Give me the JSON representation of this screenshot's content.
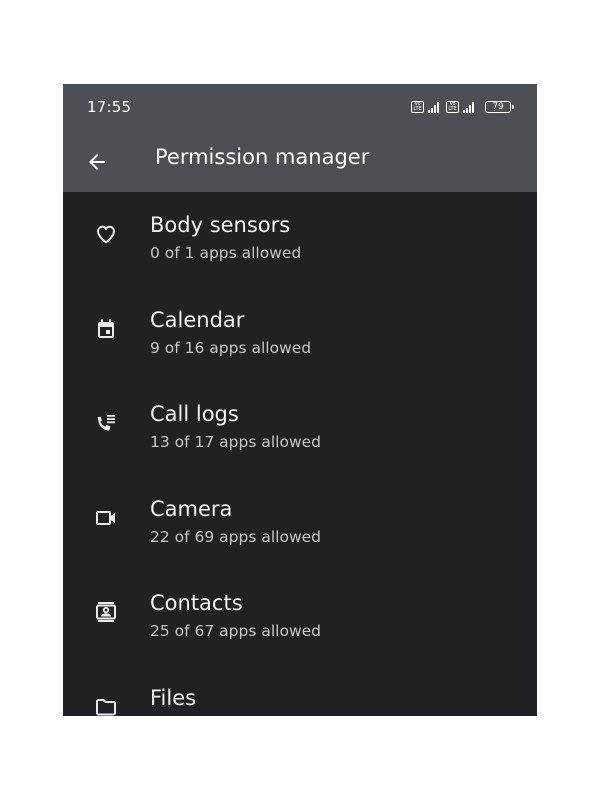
{
  "status_bar": {
    "time": "17:55",
    "sim1_badge": "Vo LTE",
    "sim2_badge": "Vo LTE",
    "battery_level": "79"
  },
  "app_bar": {
    "title": "Permission manager",
    "back_icon": "arrow-back-icon"
  },
  "permissions": [
    {
      "label": "Body sensors",
      "summary": "0 of 1 apps allowed",
      "icon": "heart-icon"
    },
    {
      "label": "Calendar",
      "summary": "9 of 16 apps allowed",
      "icon": "calendar-icon"
    },
    {
      "label": "Call logs",
      "summary": "13 of 17 apps allowed",
      "icon": "call-log-icon"
    },
    {
      "label": "Camera",
      "summary": "22 of 69 apps allowed",
      "icon": "videocam-icon"
    },
    {
      "label": "Contacts",
      "summary": "25 of 67 apps allowed",
      "icon": "contacts-icon"
    },
    {
      "label": "Files",
      "summary": "",
      "icon": "folder-icon"
    }
  ],
  "colors": {
    "app_bar_background": "#4c5054",
    "list_background": "#1f2124",
    "primary_text": "#f1f3f4",
    "secondary_text": "#c4c7cb"
  }
}
